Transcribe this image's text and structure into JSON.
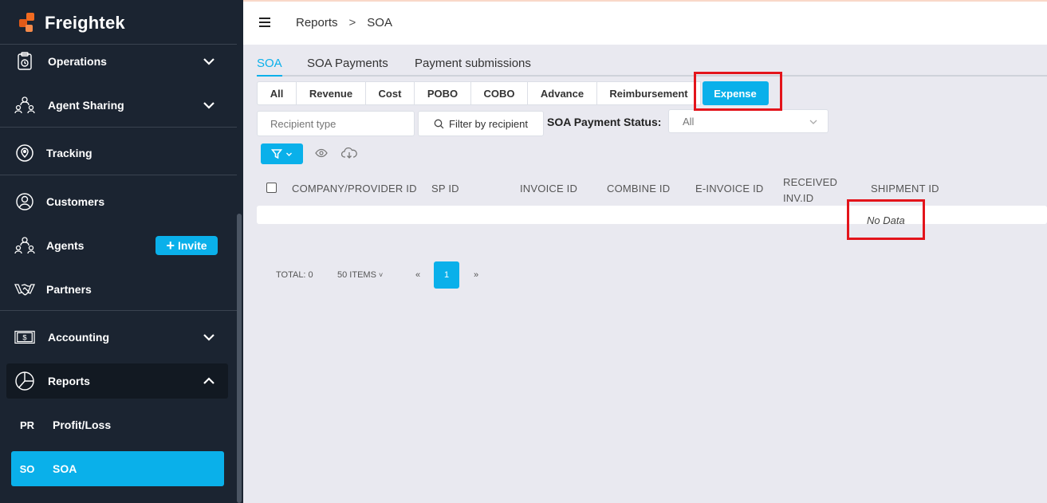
{
  "app": {
    "name": "Freightek"
  },
  "sidebar": {
    "items": [
      {
        "label": "Operations",
        "icon": "clipboard-icon"
      },
      {
        "label": "Agent Sharing",
        "icon": "share-people-icon"
      },
      {
        "label": "Tracking",
        "icon": "location-pin-icon"
      },
      {
        "label": "Customers",
        "icon": "user-circle-icon"
      },
      {
        "label": "Agents",
        "icon": "agents-icon",
        "invite_label": "Invite"
      },
      {
        "label": "Partners",
        "icon": "handshake-icon"
      },
      {
        "label": "Accounting",
        "icon": "dollar-bill-icon"
      },
      {
        "label": "Reports",
        "icon": "pie-chart-icon"
      }
    ],
    "subitems": [
      {
        "abbr": "PR",
        "label": "Profit/Loss"
      },
      {
        "abbr": "SO",
        "label": "SOA"
      }
    ]
  },
  "breadcrumb": {
    "parent": "Reports",
    "sep": ">",
    "current": "SOA"
  },
  "tabs": [
    "SOA",
    "SOA Payments",
    "Payment submissions"
  ],
  "categories": [
    "All",
    "Revenue",
    "Cost",
    "POBO",
    "COBO",
    "Advance",
    "Reimbursement",
    "Expense"
  ],
  "filters": {
    "recipient_placeholder": "Recipient type",
    "filter_button": "Filter by recipient",
    "status_label": "SOA Payment Status:",
    "status_value": "All"
  },
  "table": {
    "columns": [
      "COMPANY/PROVIDER ID",
      "SP ID",
      "INVOICE ID",
      "COMBINE ID",
      "E-INVOICE ID",
      "RECEIVED",
      "INV.ID",
      "SHIPMENT ID"
    ],
    "empty_text": "No Data"
  },
  "pagination": {
    "total": "TOTAL: 0",
    "page_size": "50 ITEMS",
    "prev": "«",
    "page": "1",
    "next": "»"
  },
  "colors": {
    "accent": "#0ab0ea",
    "sidebar": "#1b2431",
    "highlight": "#e3141b",
    "logo": "#f26b21"
  }
}
